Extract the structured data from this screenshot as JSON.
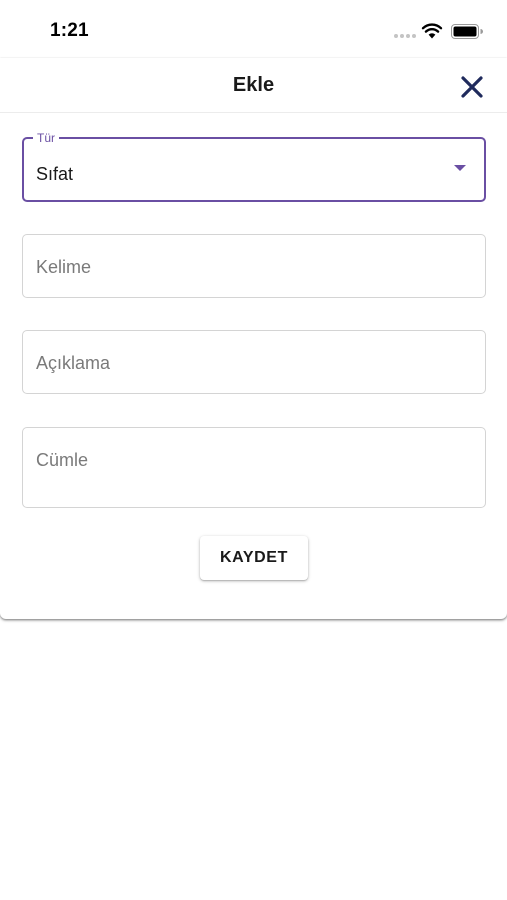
{
  "status_bar": {
    "time": "1:21",
    "icons": [
      "signal-dots-icon",
      "wifi-icon",
      "battery-icon"
    ]
  },
  "sheet": {
    "title": "Ekle",
    "close_icon": "close-icon"
  },
  "form": {
    "type_field": {
      "label": "Tür",
      "value": "Sıfat"
    },
    "word_field": {
      "placeholder": "Kelime",
      "value": ""
    },
    "description_field": {
      "placeholder": "Açıklama",
      "value": ""
    },
    "sentence_field": {
      "placeholder": "Cümle",
      "value": ""
    },
    "save_label": "KAYDET"
  },
  "colors": {
    "accent": "#6a4fa3",
    "close_icon": "#1f2a5c",
    "border": "#d4d4d4",
    "placeholder": "#7a7a7a"
  }
}
